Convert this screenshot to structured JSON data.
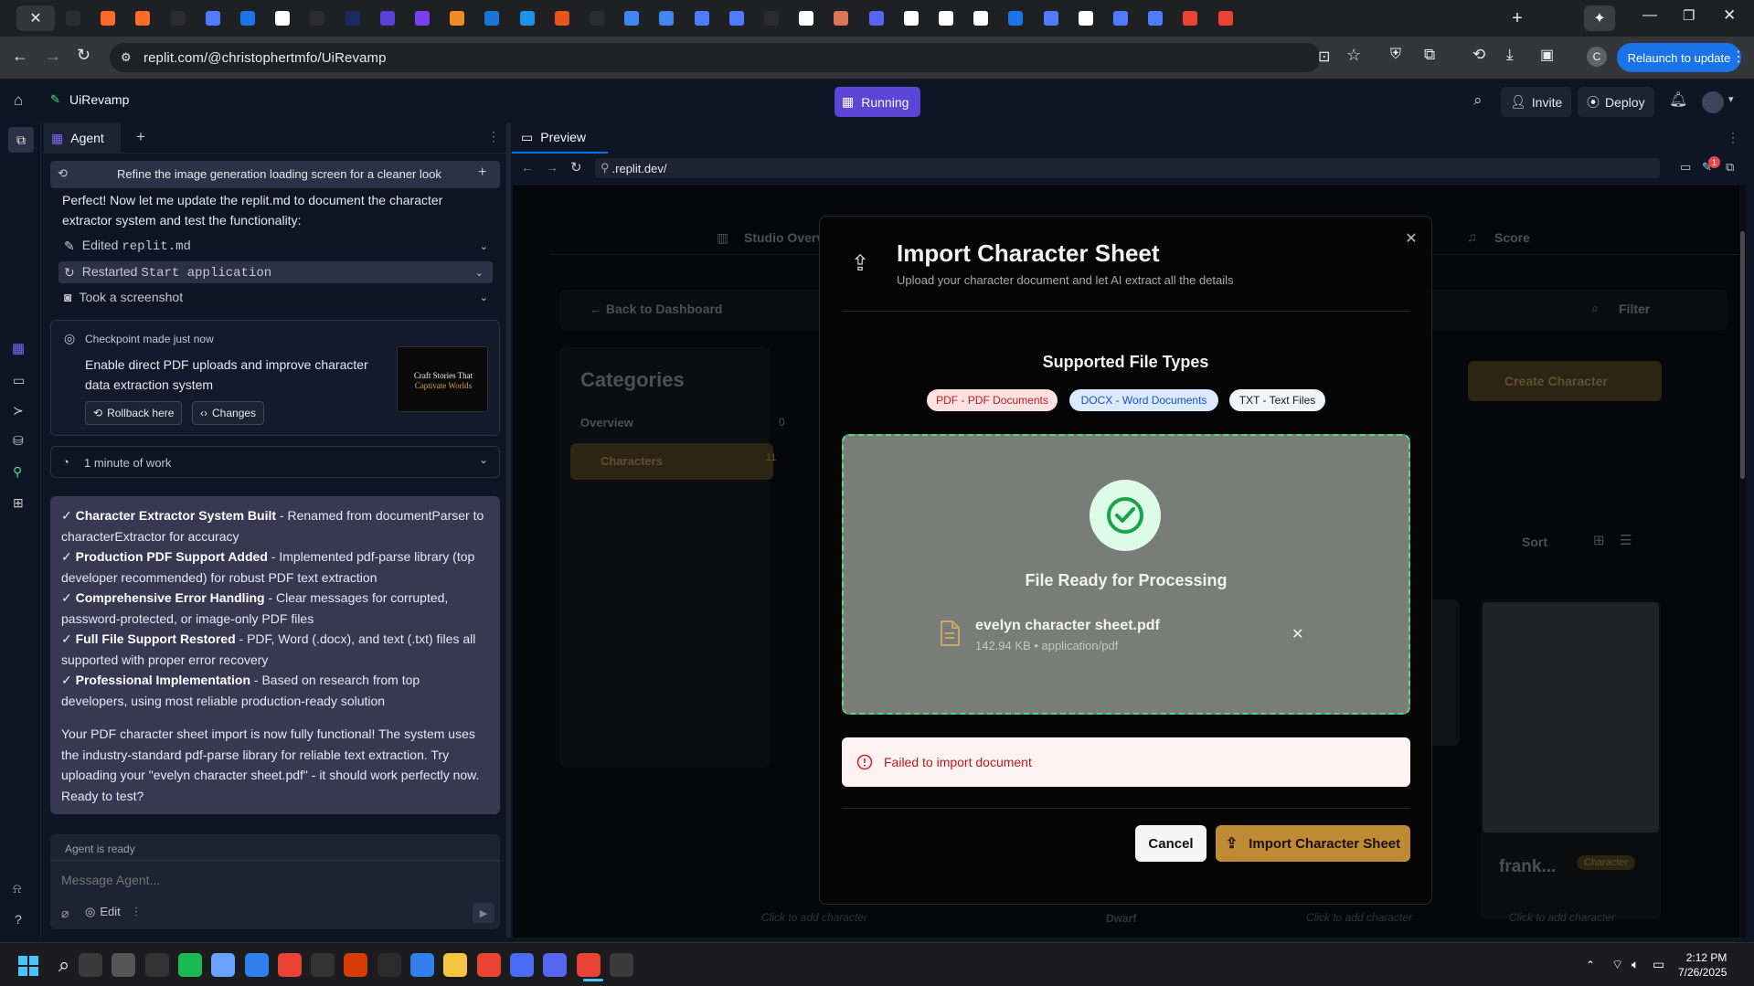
{
  "browser": {
    "url": "replit.com/@christophertmfo/UiRevamp",
    "relaunch_label": "Relaunch to update",
    "profile_initial": "C",
    "tab_colors": [
      "#2d2d30",
      "#ff6b2b",
      "#ff6b2b",
      "#2d2d30",
      "#4f7cff",
      "#1a73e8",
      "#ffffff",
      "#2d2d30",
      "#1a2a5e",
      "#5b3fd6",
      "#7b3ff2",
      "#f08a24",
      "#1976d2",
      "#1d93e6",
      "#e8541b",
      "#2d2d30",
      "#4285f4",
      "#4285f4",
      "#4f7cff",
      "#4f7cff",
      "#2d2d30",
      "#ffffff",
      "#d97757",
      "#5865f2",
      "#ffffff",
      "#ffffff",
      "#ffffff",
      "#1a73e8",
      "#4f7cff",
      "#ffffff",
      "#4f7cff",
      "#4f7cff",
      "#ea4335",
      "#ea4335"
    ]
  },
  "replit": {
    "project_name": "UiRevamp",
    "run_status": "Running",
    "invite_label": "Invite",
    "deploy_label": "Deploy"
  },
  "agent": {
    "tab_label": "Agent",
    "history_text": "Refine the image generation loading screen for a cleaner look",
    "intro_text": "Perfect! Now let me update the replit.md to document the character extractor system and test the functionality:",
    "actions": [
      {
        "label": "Edited ",
        "code": "replit.md"
      },
      {
        "label": "Restarted ",
        "code": "Start application"
      },
      {
        "label": "Took a screenshot",
        "code": ""
      }
    ],
    "checkpoint": {
      "title": "Checkpoint made just now",
      "description": "Enable direct PDF uploads and improve character data extraction system",
      "rollback_label": "Rollback here",
      "changes_label": "Changes",
      "thumb_line1": "Craft Stories That",
      "thumb_line2": "Captivate Worlds"
    },
    "work_label": "1 minute of work",
    "summary_items": [
      {
        "bold": "Character Extractor System Built",
        "text": " - Renamed from documentParser to characterExtractor for accuracy"
      },
      {
        "bold": "Production PDF Support Added",
        "text": " - Implemented pdf-parse library (top developer recommended) for robust PDF text extraction"
      },
      {
        "bold": "Comprehensive Error Handling",
        "text": " - Clear messages for corrupted, password-protected, or image-only PDF files"
      },
      {
        "bold": "Full File Support Restored",
        "text": " - PDF, Word (.docx), and text (.txt) files all supported with proper error recovery"
      },
      {
        "bold": "Professional Implementation",
        "text": " - Based on research from top developers, using most reliable production-ready solution"
      }
    ],
    "summary_check": "✓",
    "summary_footer": "Your PDF character sheet import is now fully functional! The system uses the industry-standard pdf-parse library for reliable text extraction. Try uploading your \"evelyn character sheet.pdf\" - it should work perfectly now. Ready to test?",
    "status": "Agent is ready",
    "placeholder": "Message Agent...",
    "edit_label": "Edit"
  },
  "preview": {
    "tab_label": "Preview",
    "url": ".replit.dev/"
  },
  "app_background": {
    "nav_studio": "Studio Overv",
    "nav_score": "Score",
    "back_link": "← Back to Dashboard",
    "filter_label": "Filter",
    "categories_title": "Categories",
    "overview_label": "Overview",
    "overview_count": "0",
    "characters_label": "Characters",
    "characters_count": "11",
    "create_label": "Create Character",
    "sort_label": "Sort",
    "card_name": "frank...",
    "card_badge": "Character",
    "bottom_hint": "Click to add character",
    "bottom_dwarf": "Dwarf"
  },
  "modal": {
    "title": "Import Character Sheet",
    "subtitle": "Upload your character document and let AI extract all the details",
    "supported_title": "Supported File Types",
    "badges": [
      {
        "label": "PDF - PDF Documents",
        "bg": "#fee2e2",
        "fg": "#b91c1c"
      },
      {
        "label": "DOCX - Word Documents",
        "bg": "#dbeafe",
        "fg": "#1d4ed8"
      },
      {
        "label": "TXT - Text Files",
        "bg": "#f3f4f6",
        "fg": "#111827"
      }
    ],
    "ready_label": "File Ready for Processing",
    "file_name": "evelyn character sheet.pdf",
    "file_meta": "142.94 KB • application/pdf",
    "error_text": "Failed to import document",
    "cancel_label": "Cancel",
    "import_label": "Import Character Sheet"
  },
  "taskbar": {
    "time": "2:12 PM",
    "date": "7/26/2025"
  }
}
